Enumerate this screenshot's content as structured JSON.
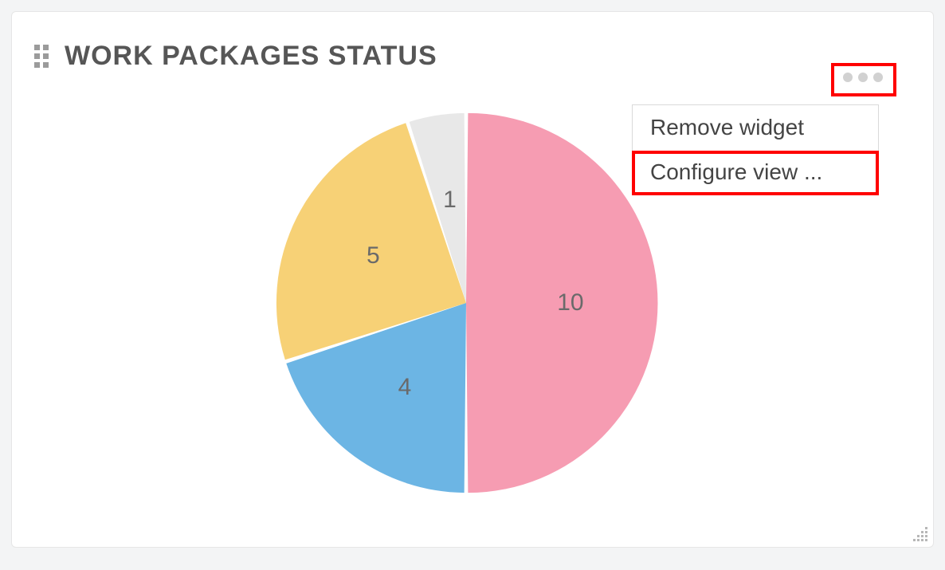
{
  "widget": {
    "title": "WORK PACKAGES STATUS"
  },
  "menu": {
    "remove": "Remove widget",
    "configure": "Configure view ..."
  },
  "chart_data": {
    "type": "pie",
    "title": "Work packages status",
    "series": [
      {
        "name": "status-pink",
        "value": 10,
        "label": "10",
        "color": "#f69cb2"
      },
      {
        "name": "status-blue",
        "value": 4,
        "label": "4",
        "color": "#6cb5e4"
      },
      {
        "name": "status-yellow",
        "value": 5,
        "label": "5",
        "color": "#f7d176"
      },
      {
        "name": "status-grey",
        "value": 1,
        "label": "1",
        "color": "#e8e8e8"
      }
    ]
  }
}
